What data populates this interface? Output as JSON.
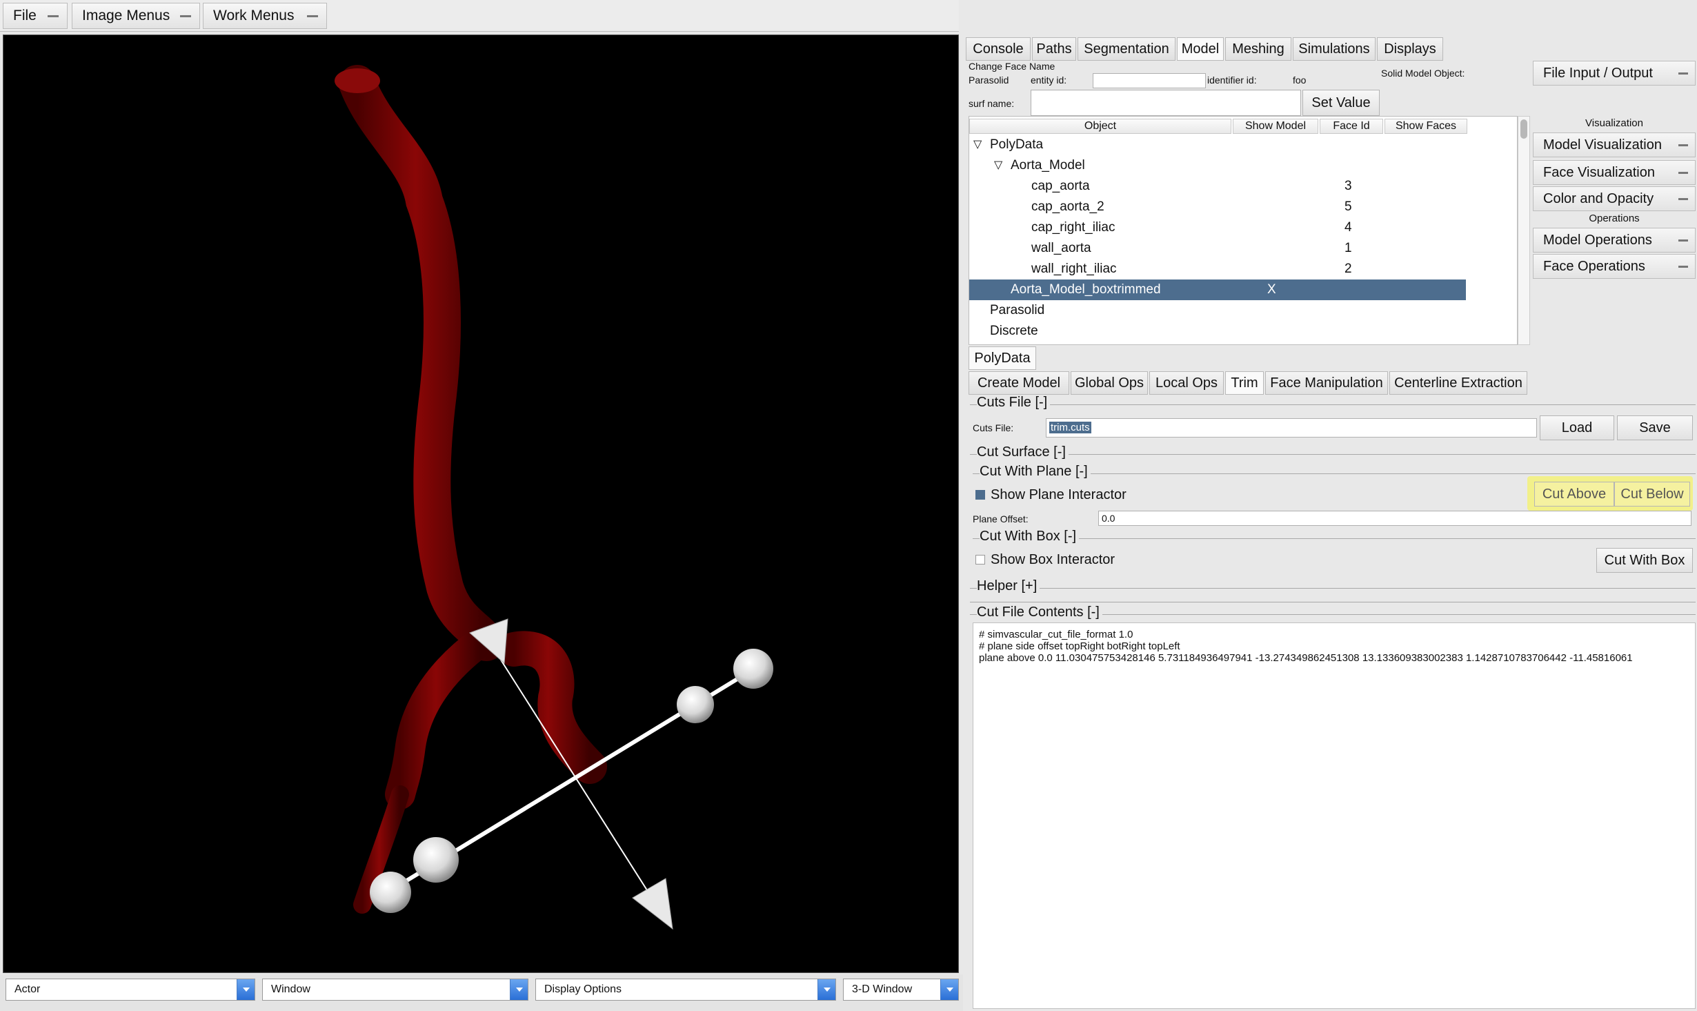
{
  "menubar": {
    "file": "File",
    "image_menus": "Image Menus",
    "work_menus": "Work Menus"
  },
  "bottom_bar": {
    "actor": "Actor",
    "window": "Window",
    "display_options": "Display Options",
    "view": "3-D Window"
  },
  "main_tabs": [
    "Console",
    "Paths",
    "Segmentation",
    "Model",
    "Meshing",
    "Simulations",
    "Displays"
  ],
  "face_name": {
    "title": "Change Face Name",
    "parasolid": "Parasolid",
    "entity_id_label": "entity id:",
    "entity_id_value": "",
    "identifier_label": "identifier id:",
    "identifier_value": "foo",
    "surf_name_label": "surf name:",
    "surf_name_value": "",
    "set_value": "Set Value",
    "solid_model_label": "Solid Model Object:"
  },
  "tree": {
    "headers": [
      "Object",
      "Show Model",
      "Face Id",
      "Show Faces"
    ],
    "rows": [
      {
        "label": "PolyData",
        "show": "",
        "face": ""
      },
      {
        "label": "Aorta_Model",
        "show": "",
        "face": ""
      },
      {
        "label": "cap_aorta",
        "show": "",
        "face": "3"
      },
      {
        "label": "cap_aorta_2",
        "show": "",
        "face": "5"
      },
      {
        "label": "cap_right_iliac",
        "show": "",
        "face": "4"
      },
      {
        "label": "wall_aorta",
        "show": "",
        "face": "1"
      },
      {
        "label": "wall_right_iliac",
        "show": "",
        "face": "2"
      },
      {
        "label": "Aorta_Model_boxtrimmed",
        "show": "X",
        "face": ""
      },
      {
        "label": "Parasolid",
        "show": "",
        "face": ""
      },
      {
        "label": "Discrete",
        "show": "",
        "face": ""
      }
    ]
  },
  "side": {
    "file_io": "File Input / Output",
    "visualization_hdr": "Visualization",
    "model_vis": "Model Visualization",
    "face_vis": "Face Visualization",
    "color_opacity": "Color and Opacity",
    "operations_hdr": "Operations",
    "model_ops": "Model Operations",
    "face_ops": "Face Operations"
  },
  "polydata_tab": "PolyData",
  "sub_tabs": [
    "Create Model",
    "Global Ops",
    "Local Ops",
    "Trim",
    "Face Manipulation",
    "Centerline Extraction"
  ],
  "cuts": {
    "cuts_file_title": "Cuts File [-]",
    "cuts_file_label": "Cuts File:",
    "cuts_file_value": "trim.cuts",
    "load": "Load",
    "save": "Save",
    "cut_surface_title": "Cut Surface [-]",
    "cut_plane_title": "Cut With Plane [-]",
    "show_plane": "Show Plane Interactor",
    "cut_above": "Cut Above",
    "cut_below": "Cut Below",
    "plane_offset_label": "Plane Offset:",
    "plane_offset_value": "0.0",
    "cut_box_title": "Cut With Box [-]",
    "show_box": "Show Box Interactor",
    "cut_with_box": "Cut With Box",
    "helper_title": "Helper [+]",
    "contents_title": "Cut File Contents [-]",
    "contents": [
      "# simvascular_cut_file_format 1.0",
      "# plane side offset topRight botRight topLeft",
      "plane above 0.0  11.030475753428146 5.731184936497941 -13.274349862451308  13.133609383002383 1.1428710783706442 -11.45816061"
    ]
  },
  "colors": {
    "vessel": "#7a0000",
    "selection": "#4d6d8e",
    "highlight": "#f2f08a"
  }
}
